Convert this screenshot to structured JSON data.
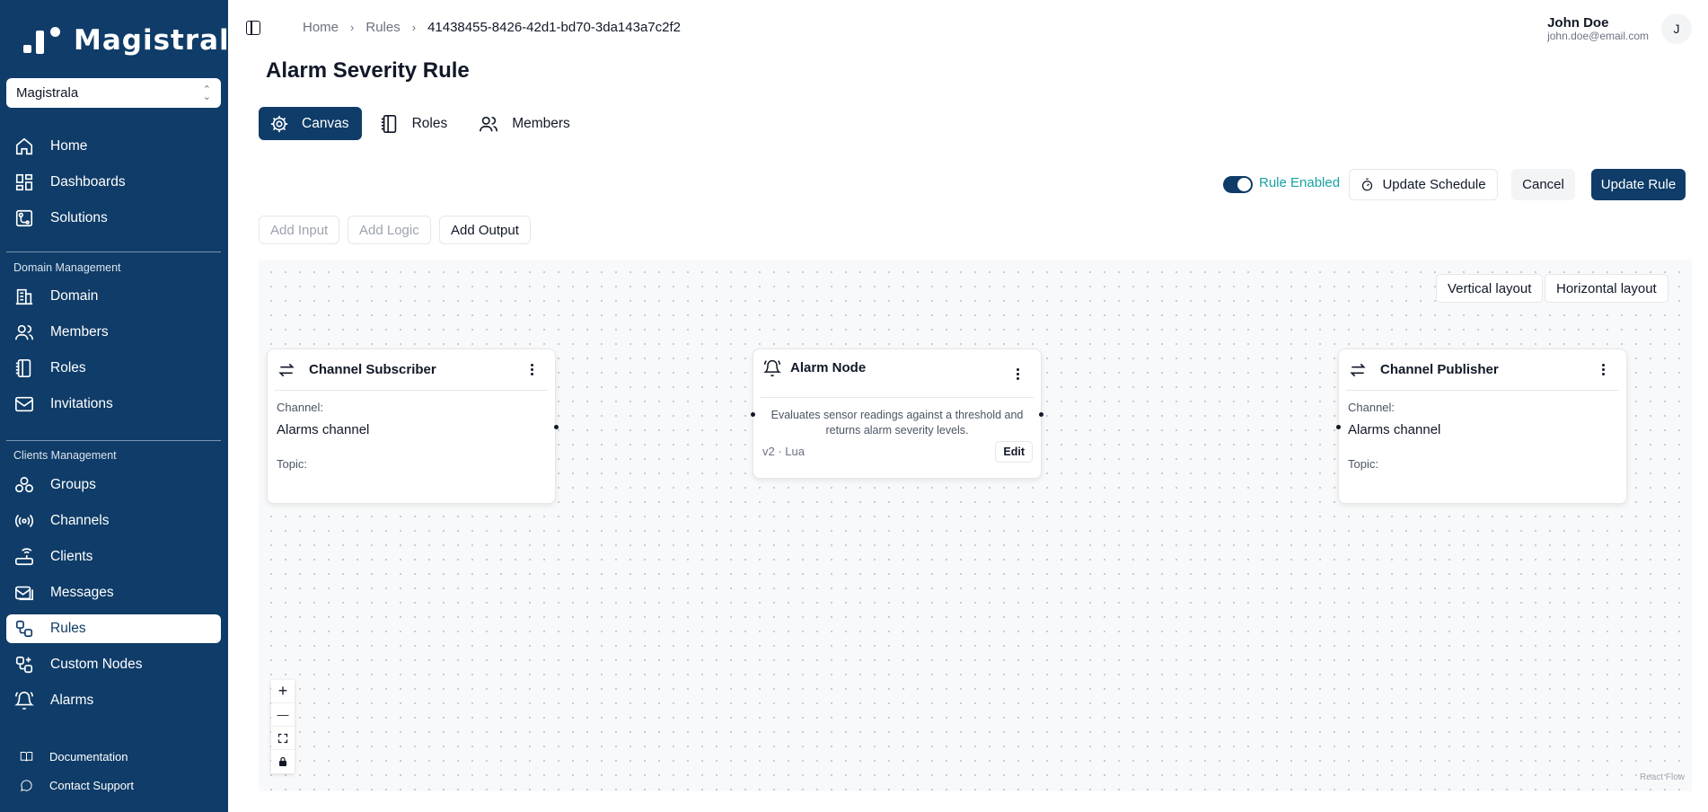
{
  "app": {
    "name": "Magistrala"
  },
  "domain_select": {
    "value": "Magistrala"
  },
  "sidebar": {
    "main_items": [
      {
        "label": "Home",
        "icon": "home-icon"
      },
      {
        "label": "Dashboards",
        "icon": "dashboard-icon"
      },
      {
        "label": "Solutions",
        "icon": "solutions-icon"
      }
    ],
    "domain_section": "Domain Management",
    "domain_items": [
      {
        "label": "Domain",
        "icon": "building-icon"
      },
      {
        "label": "Members",
        "icon": "users-icon"
      },
      {
        "label": "Roles",
        "icon": "notebook-icon"
      },
      {
        "label": "Invitations",
        "icon": "mail-icon"
      }
    ],
    "clients_section": "Clients Management",
    "clients_items": [
      {
        "label": "Groups",
        "icon": "groups-icon"
      },
      {
        "label": "Channels",
        "icon": "radio-icon"
      },
      {
        "label": "Clients",
        "icon": "router-icon"
      },
      {
        "label": "Messages",
        "icon": "messages-icon"
      },
      {
        "label": "Rules",
        "icon": "workflow-icon",
        "active": true
      },
      {
        "label": "Custom Nodes",
        "icon": "custom-nodes-icon"
      },
      {
        "label": "Alarms",
        "icon": "bell-icon"
      }
    ],
    "footer": [
      {
        "label": "Documentation",
        "icon": "book-icon"
      },
      {
        "label": "Contact Support",
        "icon": "chat-icon"
      }
    ]
  },
  "breadcrumb": {
    "home": "Home",
    "rules": "Rules",
    "current": "41438455-8426-42d1-bd70-3da143a7c2f2"
  },
  "user": {
    "name": "John Doe",
    "email": "john.doe@email.com",
    "initial": "J"
  },
  "page": {
    "title": "Alarm Severity Rule"
  },
  "tabs": [
    {
      "label": "Canvas",
      "icon": "gear-icon",
      "active": true
    },
    {
      "label": "Roles",
      "icon": "notebook-icon"
    },
    {
      "label": "Members",
      "icon": "users-icon"
    }
  ],
  "actions": {
    "toggle_label": "Rule Enabled",
    "toggle_on": true,
    "update_schedule": "Update Schedule",
    "cancel": "Cancel",
    "update_rule": "Update Rule"
  },
  "add_buttons": {
    "input": "Add Input",
    "logic": "Add Logic",
    "output": "Add Output"
  },
  "layout_buttons": {
    "vertical": "Vertical layout",
    "horizontal": "Horizontal layout"
  },
  "nodes": {
    "subscriber": {
      "title": "Channel Subscriber",
      "channel_label": "Channel:",
      "channel_value": "Alarms channel",
      "topic_label": "Topic:"
    },
    "alarm": {
      "title": "Alarm Node",
      "description": "Evaluates sensor readings against a threshold and returns alarm severity levels.",
      "meta": "v2 · Lua",
      "edit": "Edit"
    },
    "publisher": {
      "title": "Channel Publisher",
      "channel_label": "Channel:",
      "channel_value": "Alarms channel",
      "topic_label": "Topic:"
    }
  },
  "controls": {
    "zoom_in": "+",
    "zoom_out": "—"
  },
  "attribution": "React Flow",
  "colors": {
    "sidebar": "#0f3c68",
    "primary": "#0f3c68",
    "toggle_label": "#16a3a0"
  }
}
